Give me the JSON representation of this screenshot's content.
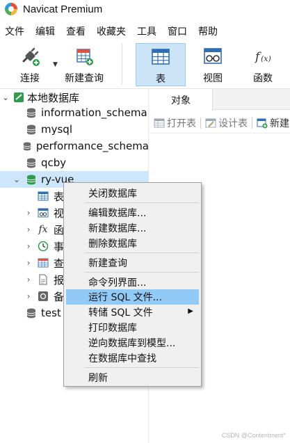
{
  "app": {
    "title": "Navicat Premium"
  },
  "menubar": [
    "文件",
    "编辑",
    "查看",
    "收藏夹",
    "工具",
    "窗口",
    "帮助"
  ],
  "toolbar": {
    "connect": "连接",
    "new_query": "新建查询",
    "table": "表",
    "view": "视图",
    "function": "函数"
  },
  "tree": {
    "root": "本地数据库",
    "databases": [
      "information_schema",
      "mysql",
      "performance_schema",
      "qcby",
      "ry-vue"
    ],
    "children": [
      "表",
      "视",
      "函",
      "事",
      "查",
      "报",
      "备"
    ],
    "last": "test"
  },
  "objects": {
    "tab": "对象",
    "open_table": "打开表",
    "design_table": "设计表",
    "new_table": "新建"
  },
  "context_menu": {
    "close_db": "关闭数据库",
    "edit_db": "编辑数据库...",
    "new_db": "新建数据库...",
    "delete_db": "删除数据库",
    "new_query": "新建查询",
    "console": "命令列界面...",
    "run_sql": "运行 SQL 文件...",
    "dump_sql": "转储 SQL 文件",
    "print_db": "打印数据库",
    "reverse_model": "逆向数据库到模型...",
    "find_in_db": "在数据库中查找",
    "refresh": "刷新"
  },
  "watermark": "CSDN @Contentment°",
  "colors": {
    "selection": "#cde6fb",
    "menu_highlight": "#91c9f7",
    "active_tool": "#cce4f7",
    "db_green": "#2e9c4a"
  }
}
